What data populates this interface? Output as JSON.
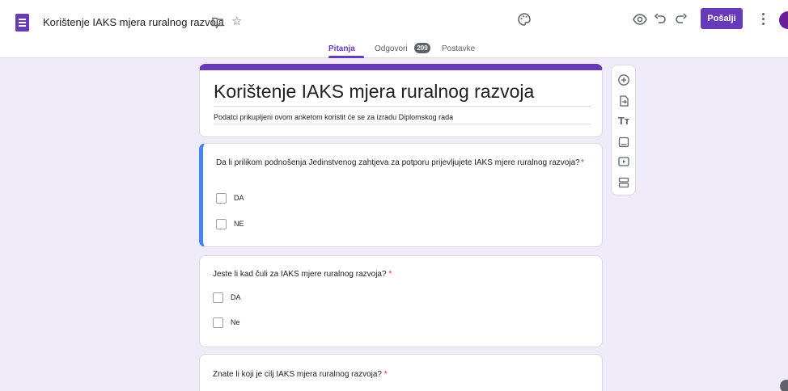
{
  "header": {
    "title": "Korištenje IAKS mjera ruralnog razvoja",
    "send_label": "Pošalji",
    "icons": [
      "palette-icon",
      "preview-icon",
      "undo-icon",
      "redo-icon",
      "more-vert-icon",
      "folder-icon",
      "star-icon"
    ]
  },
  "tabs": [
    {
      "label": "Pitanja"
    },
    {
      "label": "Odgovori"
    },
    {
      "label": "Postavke"
    }
  ],
  "responses_count": "209",
  "form": {
    "title": "Korištenje IAKS mjera ruralnog razvoja",
    "description": "Podatci prikupljeni ovom anketom koristit će se za izradu Diplomskog rada"
  },
  "questions": [
    {
      "text": "Da li prilikom podnošenja Jedinstvenog zahtjeva za potporu prijevljujete IAKS mjere ruralnog razvoja?",
      "required_mark": "*",
      "options": [
        "DA",
        "NE"
      ]
    },
    {
      "text": "Jeste li kad čuli za IAKS mjere ruralnog razvoja?",
      "required_mark": "*",
      "options": [
        "DA",
        "Ne"
      ]
    },
    {
      "text": "Znate li koji je cilj IAKS mjera ruralnog razvoja?",
      "required_mark": "*",
      "options": []
    }
  ],
  "side_toolbar": [
    "add-question-icon",
    "import-questions-icon",
    "add-title-icon",
    "add-image-icon",
    "add-video-icon",
    "add-section-icon"
  ],
  "colors": {
    "accent": "#673ab7",
    "background": "#f0ebf8",
    "active_question_border": "#4285f4",
    "required": "#d93025"
  }
}
